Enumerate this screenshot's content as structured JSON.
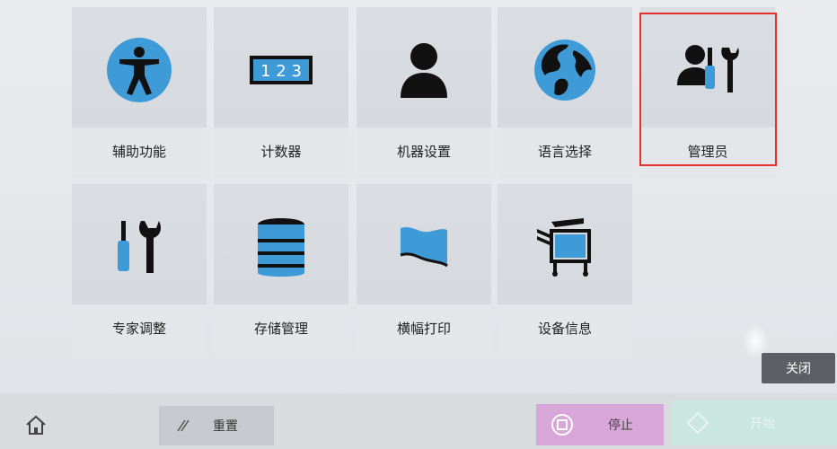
{
  "tiles": [
    {
      "label": "辅助功能",
      "icon": "accessibility-icon"
    },
    {
      "label": "计数器",
      "icon": "counter-icon",
      "counter_digits": "1 2 3"
    },
    {
      "label": "机器设置",
      "icon": "user-icon"
    },
    {
      "label": "语言选择",
      "icon": "globe-icon"
    },
    {
      "label": "管理员",
      "icon": "admin-icon"
    },
    {
      "label": "专家调整",
      "icon": "tools-icon"
    },
    {
      "label": "存储管理",
      "icon": "database-icon"
    },
    {
      "label": "横幅打印",
      "icon": "banner-icon"
    },
    {
      "label": "设备信息",
      "icon": "printer-icon"
    }
  ],
  "buttons": {
    "close": "关闭",
    "reset": "重置",
    "stop": "停止",
    "start": "开始"
  },
  "colors": {
    "accent_blue": "#3f9ad8",
    "highlight_red": "#e3312d",
    "stop_bg": "#d8a6d8",
    "start_bg": "#c9e6df"
  }
}
